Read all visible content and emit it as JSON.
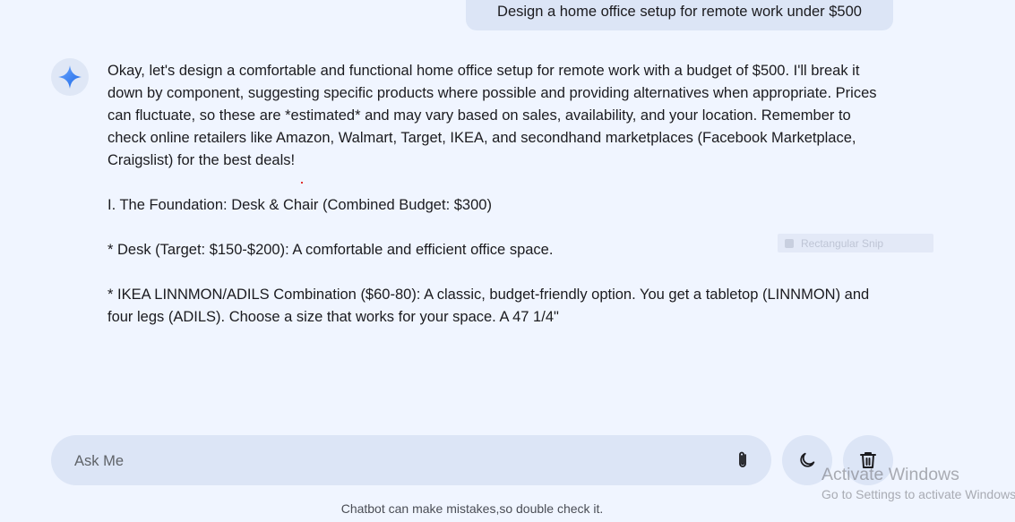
{
  "chat": {
    "user_message": "Design a home office setup for remote work under $500",
    "bot_paragraphs": [
      "Okay, let's design a comfortable and functional home office setup for remote work with a budget of $500. I'll break it down by component, suggesting specific products where possible and providing alternatives when appropriate. Prices can fluctuate, so these are *estimated* and may vary based on sales, availability, and your location. Remember to check online retailers like Amazon, Walmart, Target, IKEA, and secondhand marketplaces (Facebook Marketplace, Craigslist) for the best deals!",
      "I. The Foundation: Desk & Chair (Combined Budget: $300)",
      "* Desk (Target: $150-$200): A comfortable and efficient office space.",
      "* IKEA LINNMON/ADILS Combination ($60-80): A classic, budget-friendly option. You get a tabletop (LINNMON) and four legs (ADILS). Choose a size that works for your space. A 47 1/4\""
    ]
  },
  "overlay": {
    "snip_label": "Rectangular Snip"
  },
  "input": {
    "placeholder": "Ask Me",
    "value": ""
  },
  "icons": {
    "bot_avatar": "sparkle-icon",
    "attach": "paperclip-icon",
    "theme": "moon-icon",
    "delete": "trash-icon"
  },
  "colors": {
    "background": "#f0f5ff",
    "bubble": "#dce5f6",
    "accent": "#4285f4"
  },
  "footer": {
    "disclaimer": "Chatbot can make mistakes,so double check it."
  },
  "watermark": {
    "title": "Activate Windows",
    "subtitle": "Go to Settings to activate Windows."
  }
}
